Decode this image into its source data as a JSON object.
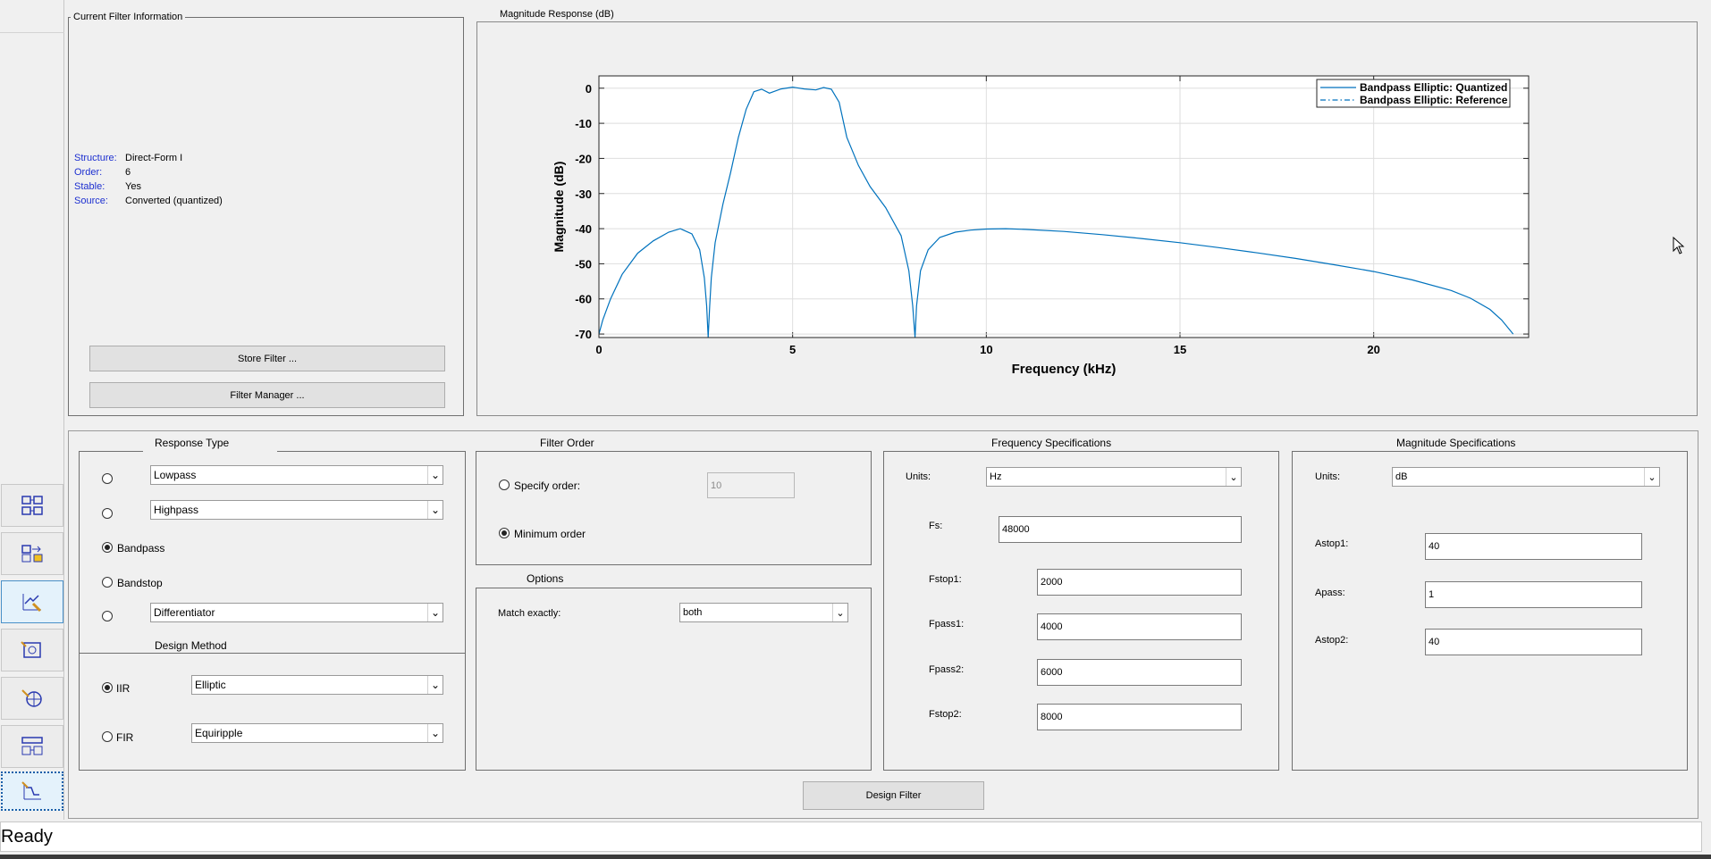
{
  "filter_info": {
    "title": "Current Filter Information",
    "rows": [
      {
        "key": "Structure:",
        "value": "Direct-Form I"
      },
      {
        "key": "Order:",
        "value": "6"
      },
      {
        "key": "Stable:",
        "value": "Yes"
      },
      {
        "key": "Source:",
        "value": "Converted (quantized)"
      }
    ],
    "store_label": "Store Filter ...",
    "manager_label": "Filter Manager ..."
  },
  "plot": {
    "panel_title": "Magnitude Response (dB)"
  },
  "chart_data": {
    "type": "line",
    "xlabel": "Frequency (kHz)",
    "ylabel": "Magnitude (dB)",
    "xlim": [
      0,
      24
    ],
    "ylim": [
      -71,
      3.5
    ],
    "xticks": [
      0,
      5,
      10,
      15,
      20
    ],
    "yticks": [
      0,
      -10,
      -20,
      -30,
      -40,
      -50,
      -60,
      -70
    ],
    "grid": true,
    "legend_position": "top-right",
    "series": [
      {
        "name": "Bandpass Elliptic: Quantized",
        "style": "solid",
        "color": "#0072bd",
        "x": [
          0,
          0.1,
          0.3,
          0.6,
          1.0,
          1.4,
          1.8,
          2.1,
          2.4,
          2.6,
          2.72,
          2.78,
          2.82,
          2.86,
          2.9,
          3.0,
          3.2,
          3.4,
          3.6,
          3.8,
          4.0,
          4.2,
          4.4,
          4.7,
          5.0,
          5.3,
          5.6,
          5.8,
          6.0,
          6.2,
          6.4,
          6.7,
          7.0,
          7.4,
          7.8,
          8.0,
          8.1,
          8.16,
          8.2,
          8.3,
          8.5,
          8.8,
          9.2,
          9.6,
          10.0,
          10.5,
          11.0,
          12.0,
          13.0,
          14.0,
          15.0,
          16.0,
          17.0,
          18.0,
          19.0,
          20.0,
          21.0,
          22.0,
          22.5,
          23.0,
          23.3,
          23.6
        ],
        "y": [
          -70,
          -66,
          -60,
          -53,
          -47,
          -43.5,
          -41,
          -40,
          -41.5,
          -46,
          -54,
          -62,
          -71,
          -62,
          -54,
          -44,
          -33,
          -24,
          -14,
          -6,
          -1,
          -0.3,
          -1.4,
          -0.2,
          0.3,
          -0.2,
          -0.5,
          0.2,
          -0.3,
          -4,
          -14,
          -22,
          -28,
          -34,
          -42,
          -52,
          -62,
          -71,
          -62,
          -52,
          -46,
          -42.5,
          -41,
          -40.4,
          -40.1,
          -40,
          -40.2,
          -40.8,
          -41.7,
          -42.8,
          -44,
          -45.4,
          -46.9,
          -48.5,
          -50.3,
          -52.2,
          -54.6,
          -57.6,
          -59.8,
          -63,
          -66,
          -70
        ]
      },
      {
        "name": "Bandpass Elliptic: Reference",
        "style": "dashdot",
        "color": "#0072bd",
        "x": [],
        "y": []
      }
    ]
  },
  "response_type": {
    "title": "Response Type",
    "lowpass": "Lowpass",
    "highpass": "Highpass",
    "bandpass": "Bandpass",
    "bandstop": "Bandstop",
    "differentiator": "Differentiator"
  },
  "design_method": {
    "title": "Design Method",
    "iir_label": "IIR",
    "iir_value": "Elliptic",
    "fir_label": "FIR",
    "fir_value": "Equiripple"
  },
  "filter_order": {
    "title": "Filter Order",
    "specify_label": "Specify order:",
    "specify_value": "10",
    "minimum_label": "Minimum order"
  },
  "options": {
    "title": "Options",
    "match_label": "Match exactly:",
    "match_value": "both"
  },
  "freq_specs": {
    "title": "Frequency Specifications",
    "units_label": "Units:",
    "units_value": "Hz",
    "fs_label": "Fs:",
    "fs_value": "48000",
    "fstop1_label": "Fstop1:",
    "fstop1_value": "2000",
    "fpass1_label": "Fpass1:",
    "fpass1_value": "4000",
    "fpass2_label": "Fpass2:",
    "fpass2_value": "6000",
    "fstop2_label": "Fstop2:",
    "fstop2_value": "8000"
  },
  "mag_specs": {
    "title": "Magnitude Specifications",
    "units_label": "Units:",
    "units_value": "dB",
    "astop1_label": "Astop1:",
    "astop1_value": "40",
    "apass_label": "Apass:",
    "apass_value": "1",
    "astop2_label": "Astop2:",
    "astop2_value": "40"
  },
  "design_button": "Design Filter",
  "status": "Ready"
}
